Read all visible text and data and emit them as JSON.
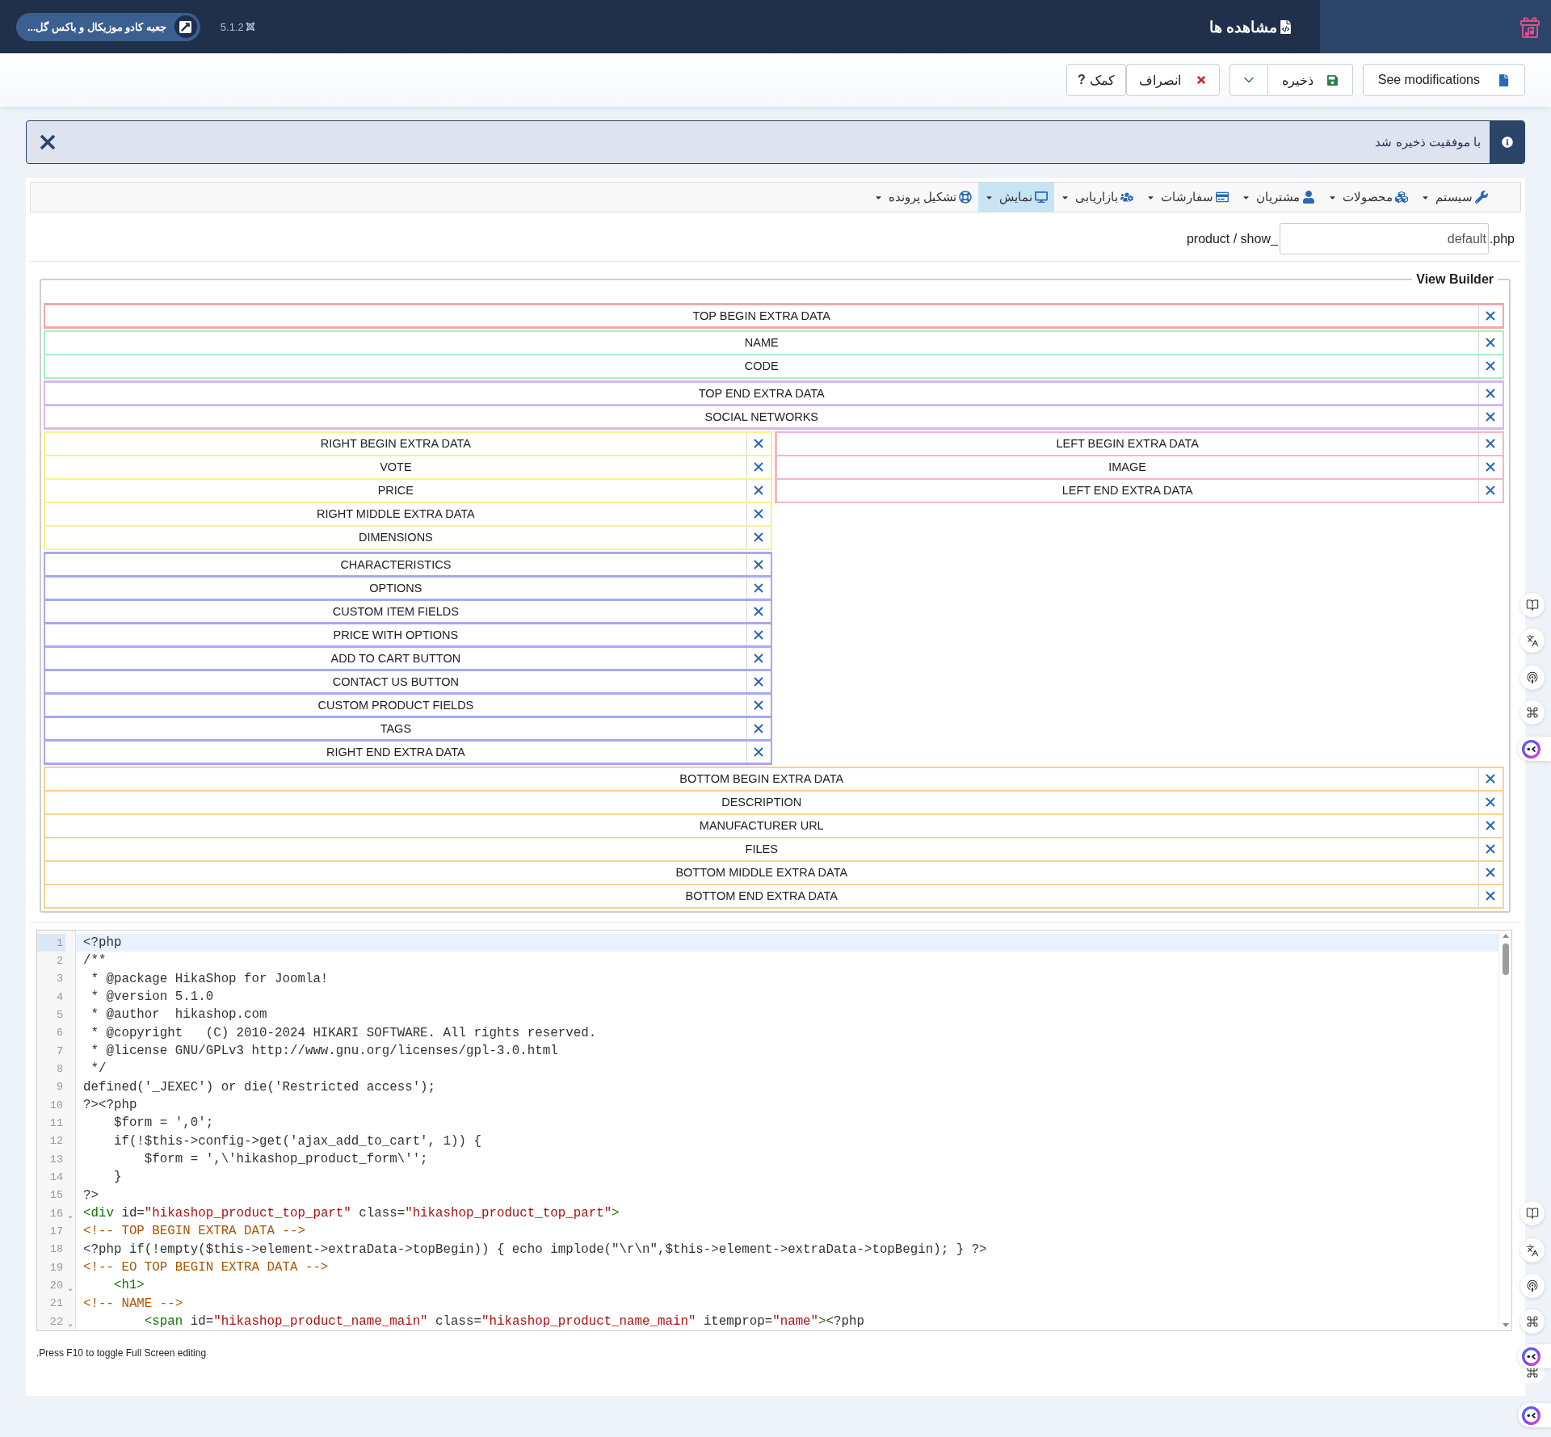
{
  "header": {
    "site_link": "جعبه کادو موزیکال و باکس گل...",
    "version": "5.1.2",
    "title": "مشاهده ها"
  },
  "toolbar": {
    "buttons": [
      {
        "kind": "document",
        "label": "See modifications"
      },
      {
        "kind": "save",
        "label": "ذخیره",
        "has_menu": true
      },
      {
        "kind": "cancel",
        "label": "انصراف"
      },
      {
        "kind": "help",
        "label": "کمک",
        "glyph": "?"
      }
    ]
  },
  "alert": {
    "message": "با موفقیت ذخیره شد"
  },
  "menu": [
    {
      "label": "سیستم",
      "selected": false
    },
    {
      "label": "محصولات",
      "selected": false
    },
    {
      "label": "مشتریان",
      "selected": false
    },
    {
      "label": "سفارشات",
      "selected": false
    },
    {
      "label": "بازاریابی",
      "selected": false
    },
    {
      "label": "نمایش",
      "selected": true
    },
    {
      "label": "تشکیل پرونده",
      "selected": false
    }
  ],
  "file": {
    "prefix": "product / show_",
    "value": "default",
    "suffix": ".php"
  },
  "view_builder": {
    "legend": "View Builder",
    "top_groups": [
      {
        "color": "#f4a7a7",
        "items": [
          "TOP BEGIN EXTRA DATA"
        ]
      },
      {
        "color": "#a6efc5",
        "items": [
          "NAME",
          "CODE"
        ]
      },
      {
        "color": "#d3b9f0",
        "items": [
          "TOP END EXTRA DATA",
          "SOCIAL NETWORKS"
        ]
      }
    ],
    "columns": [
      {
        "groups": [
          {
            "color": "#f8f28b",
            "items": [
              "RIGHT BEGIN EXTRA DATA",
              "VOTE",
              "PRICE",
              "RIGHT MIDDLE EXTRA DATA",
              "DIMENSIONS"
            ]
          },
          {
            "color": "#a7a9f3",
            "items": [
              "CHARACTERISTICS",
              "OPTIONS",
              "CUSTOM ITEM FIELDS",
              "PRICE WITH OPTIONS",
              "ADD TO CART BUTTON",
              "CONTACT US BUTTON",
              "CUSTOM PRODUCT FIELDS",
              "TAGS",
              "RIGHT END EXTRA DATA"
            ]
          }
        ]
      },
      {
        "groups": [
          {
            "color": "#f5b5c1",
            "items": [
              "LEFT BEGIN EXTRA DATA",
              "IMAGE",
              "LEFT END EXTRA DATA"
            ]
          }
        ]
      }
    ],
    "bottom_groups": [
      {
        "color": "#f8d38f",
        "items": [
          "BOTTOM BEGIN EXTRA DATA",
          "DESCRIPTION",
          "MANUFACTURER URL",
          "FILES",
          "BOTTOM MIDDLE EXTRA DATA",
          "BOTTOM END EXTRA DATA"
        ]
      }
    ]
  },
  "code_editor": {
    "lines": [
      {
        "number": "1",
        "active": true,
        "segments": [
          {
            "kind": "plain",
            "text": "<?php"
          }
        ]
      },
      {
        "number": "2",
        "active": false,
        "segments": [
          {
            "kind": "plain",
            "text": "/**"
          }
        ]
      },
      {
        "number": "3",
        "active": false,
        "segments": [
          {
            "kind": "plain",
            "text": " * @package HikaShop for Joomla!"
          }
        ]
      },
      {
        "number": "4",
        "active": false,
        "segments": [
          {
            "kind": "plain",
            "text": " * @version 5.1.0"
          }
        ]
      },
      {
        "number": "5",
        "active": false,
        "segments": [
          {
            "kind": "plain",
            "text": " * @author  hikashop.com"
          }
        ]
      },
      {
        "number": "6",
        "active": false,
        "segments": [
          {
            "kind": "plain",
            "text": " * @copyright   (C) 2010-2024 HIKARI SOFTWARE. All rights reserved."
          }
        ]
      },
      {
        "number": "7",
        "active": false,
        "segments": [
          {
            "kind": "plain",
            "text": " * @license GNU/GPLv3 http://www.gnu.org/licenses/gpl-3.0.html"
          }
        ]
      },
      {
        "number": "8",
        "active": false,
        "segments": [
          {
            "kind": "plain",
            "text": " */"
          }
        ]
      },
      {
        "number": "9",
        "active": false,
        "segments": [
          {
            "kind": "plain",
            "text": "defined('_JEXEC') or die('Restricted access');"
          }
        ]
      },
      {
        "number": "10",
        "active": false,
        "segments": [
          {
            "kind": "plain",
            "text": "?><?php"
          }
        ]
      },
      {
        "number": "11",
        "active": false,
        "segments": [
          {
            "kind": "plain",
            "text": "    $form = ',0';"
          }
        ]
      },
      {
        "number": "12",
        "active": false,
        "segments": [
          {
            "kind": "plain",
            "text": "    if(!$this->config->get('ajax_add_to_cart', 1)) {"
          }
        ]
      },
      {
        "number": "13",
        "active": false,
        "segments": [
          {
            "kind": "plain",
            "text": "        $form = ',\\'hikashop_product_form\\'';"
          }
        ]
      },
      {
        "number": "14",
        "active": false,
        "segments": [
          {
            "kind": "plain",
            "text": "    }"
          }
        ]
      },
      {
        "number": "15",
        "active": false,
        "segments": [
          {
            "kind": "plain",
            "text": "?>"
          }
        ]
      },
      {
        "number": "16",
        "fold": "⌄",
        "active": false,
        "segments": [
          {
            "kind": "tag",
            "text": "<div"
          },
          {
            "kind": "plain",
            "text": " id="
          },
          {
            "kind": "string",
            "text": "\"hikashop_product_top_part\""
          },
          {
            "kind": "plain",
            "text": " class="
          },
          {
            "kind": "string",
            "text": "\"hikashop_product_top_part\""
          },
          {
            "kind": "tag",
            "text": ">"
          }
        ]
      },
      {
        "number": "17",
        "active": false,
        "segments": [
          {
            "kind": "comment",
            "text": "<!-- TOP BEGIN EXTRA DATA -->"
          }
        ]
      },
      {
        "number": "18",
        "active": false,
        "segments": [
          {
            "kind": "plain",
            "text": "<?php if(!empty($this->element->extraData->topBegin)) { echo implode(\"\\r\\n\",$this->element->extraData->topBegin); } ?>"
          }
        ]
      },
      {
        "number": "19",
        "active": false,
        "segments": [
          {
            "kind": "comment",
            "text": "<!-- EO TOP BEGIN EXTRA DATA -->"
          }
        ]
      },
      {
        "number": "20",
        "fold": "⌄",
        "active": false,
        "segments": [
          {
            "kind": "tag",
            "text": "    <h1>"
          }
        ]
      },
      {
        "number": "21",
        "active": false,
        "segments": [
          {
            "kind": "comment",
            "text": "<!-- NAME -->"
          }
        ]
      },
      {
        "number": "22",
        "fold": "⌄",
        "active": false,
        "segments": [
          {
            "kind": "tag",
            "text": "        <span"
          },
          {
            "kind": "plain",
            "text": " id="
          },
          {
            "kind": "string",
            "text": "\"hikashop_product_name_main\""
          },
          {
            "kind": "plain",
            "text": " class="
          },
          {
            "kind": "string",
            "text": "\"hikashop_product_name_main\""
          },
          {
            "kind": "plain",
            "text": " itemprop="
          },
          {
            "kind": "string",
            "text": "\"name\""
          },
          {
            "kind": "tag",
            "text": ">"
          },
          {
            "kind": "plain",
            "text": "<?php"
          }
        ]
      }
    ]
  },
  "hint": ".Press F10 to toggle Full Screen editing"
}
